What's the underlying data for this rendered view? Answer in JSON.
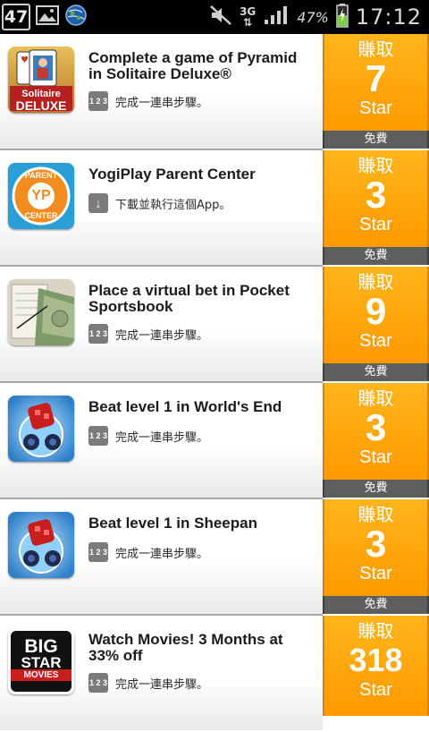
{
  "status_bar": {
    "notification_count": "47",
    "network": "3G",
    "battery": "47%",
    "time": "17:12"
  },
  "offers": [
    {
      "title": "Complete a game of Pyramid in Solitaire Deluxe®",
      "subtitle": "完成一連串步驟。",
      "subtitle_icon": "123-steps-icon",
      "chip": "1 2 3",
      "earn_label": "賺取",
      "reward": "7",
      "unit": "Star",
      "price": "免費",
      "app_icon": "solitaire-deluxe-icon",
      "icon_text": [
        "Solitaire",
        "DELUXE"
      ]
    },
    {
      "title": "YogiPlay Parent Center",
      "subtitle": "下載並執行這個App。",
      "subtitle_icon": "download-icon",
      "chip": "↓",
      "earn_label": "賺取",
      "reward": "3",
      "unit": "Star",
      "price": "免費",
      "app_icon": "yogiplay-icon",
      "icon_text": [
        "PARENT",
        "YP",
        "CENTER"
      ]
    },
    {
      "title": "Place a virtual bet in Pocket Sportsbook",
      "subtitle": "完成一連串步驟。",
      "subtitle_icon": "123-steps-icon",
      "chip": "1 2 3",
      "earn_label": "賺取",
      "reward": "9",
      "unit": "Star",
      "price": "免費",
      "app_icon": "pocket-sportsbook-icon",
      "icon_text": []
    },
    {
      "title": "Beat level 1 in World's End",
      "subtitle": "完成一連串步驟。",
      "subtitle_icon": "123-steps-icon",
      "chip": "1 2 3",
      "earn_label": "賺取",
      "reward": "3",
      "unit": "Star",
      "price": "免費",
      "app_icon": "worlds-end-icon",
      "icon_text": []
    },
    {
      "title": "Beat level 1 in Sheepan",
      "subtitle": "完成一連串步驟。",
      "subtitle_icon": "123-steps-icon",
      "chip": "1 2 3",
      "earn_label": "賺取",
      "reward": "3",
      "unit": "Star",
      "price": "免費",
      "app_icon": "sheepan-icon",
      "icon_text": []
    },
    {
      "title": "Watch Movies! 3 Months at 33% off",
      "subtitle": "完成一連串步驟。",
      "subtitle_icon": "123-steps-icon",
      "chip": "1 2 3",
      "earn_label": "賺取",
      "reward": "318",
      "unit": "Star",
      "price": "",
      "app_icon": "big-star-movies-icon",
      "icon_text": [
        "BIG",
        "STAR",
        "MOVIES"
      ]
    }
  ],
  "colors": {
    "reward_orange": "#ff9a00",
    "free_bar": "#5e5e5e",
    "status_bar": "#000000"
  }
}
